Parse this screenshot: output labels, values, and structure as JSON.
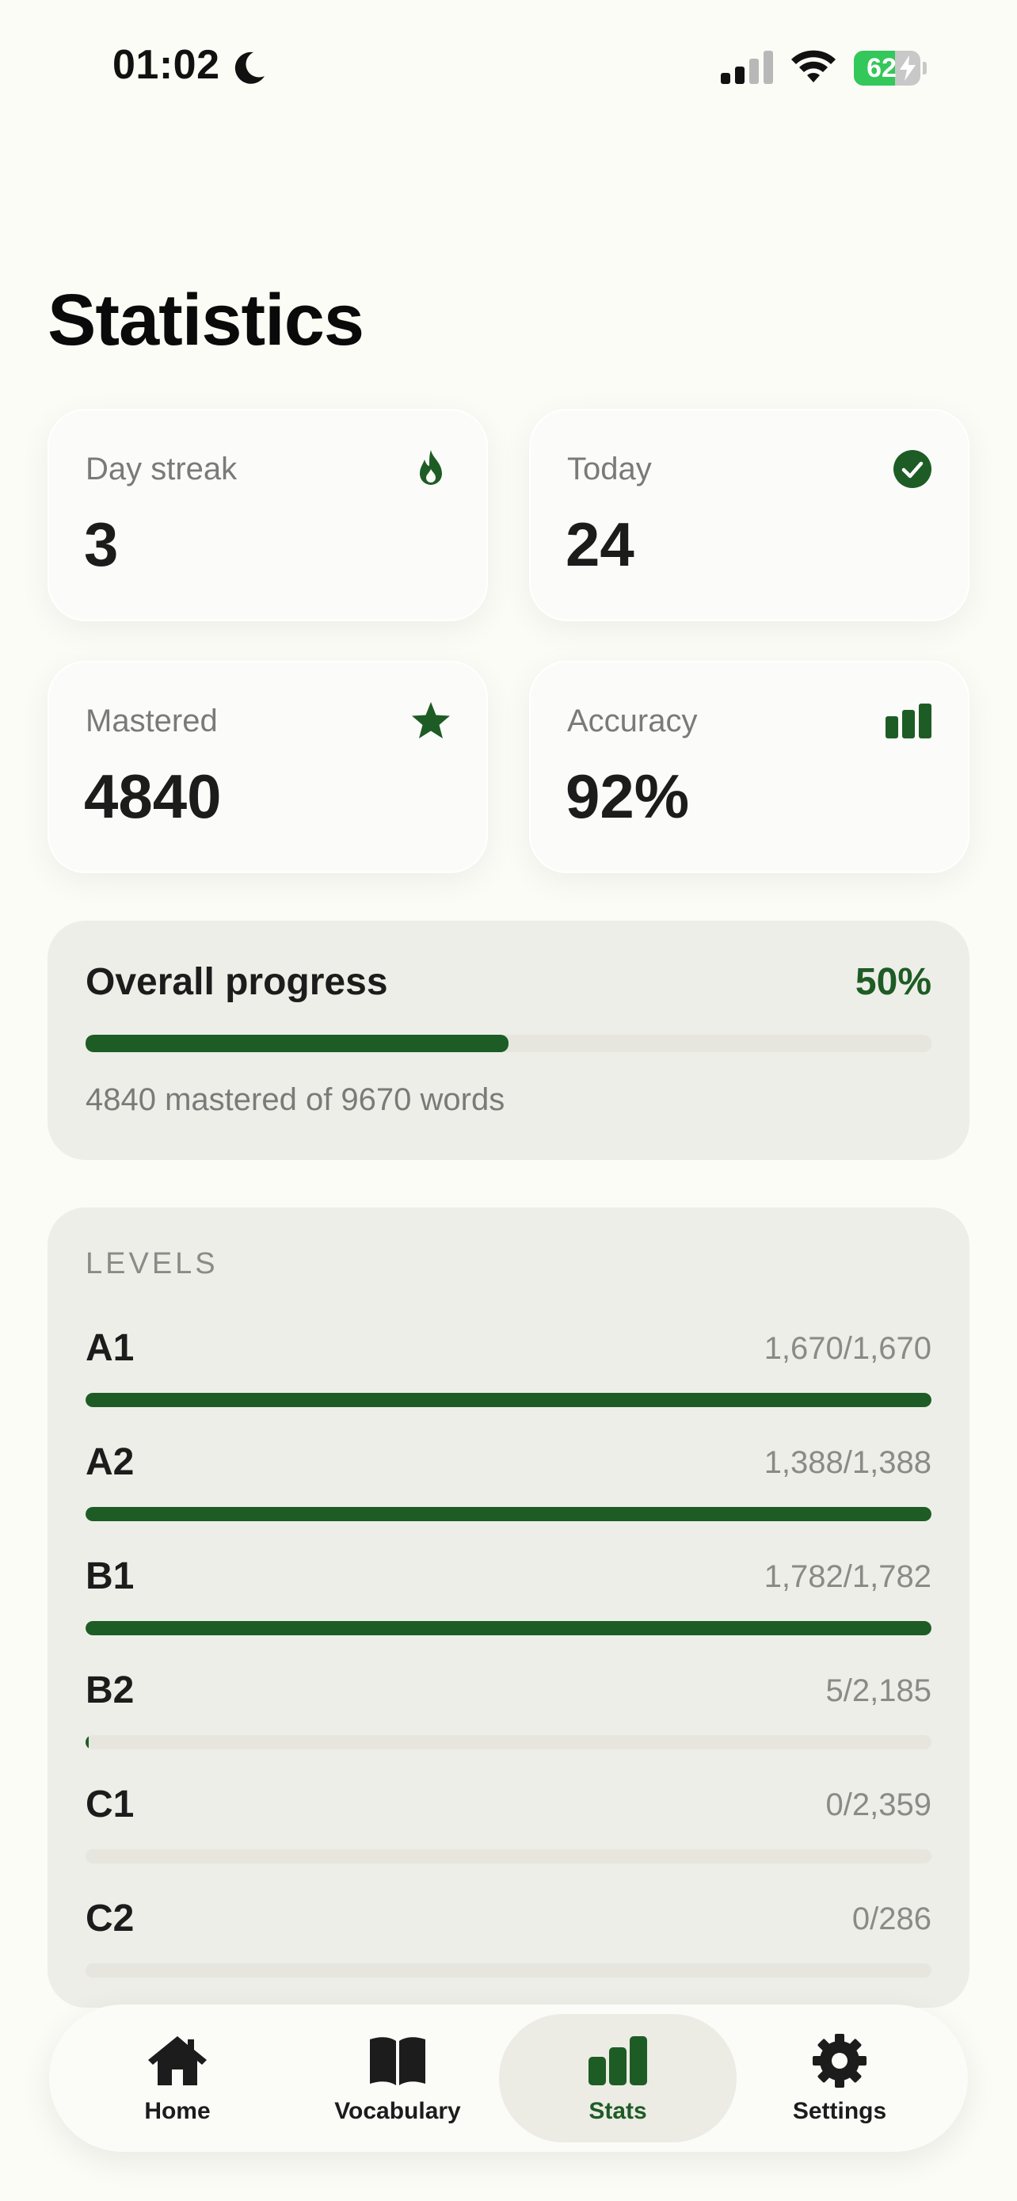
{
  "status_bar": {
    "time": "01:02",
    "battery": "62",
    "battery_level": 0.62,
    "icons": [
      "moon-icon",
      "cellular-signal-icon",
      "wifi-icon",
      "battery-charging-icon"
    ]
  },
  "page": {
    "title": "Statistics"
  },
  "stats": [
    {
      "label": "Day streak",
      "value": "3",
      "icon": "flame-icon"
    },
    {
      "label": "Today",
      "value": "24",
      "icon": "check-circle-icon"
    },
    {
      "label": "Mastered",
      "value": "4840",
      "icon": "star-icon"
    },
    {
      "label": "Accuracy",
      "value": "92%",
      "icon": "bar-chart-icon"
    }
  ],
  "overall": {
    "title": "Overall progress",
    "percent": "50%",
    "fraction": 0.5,
    "subtitle": "4840 mastered of 9670 words"
  },
  "levels": {
    "heading": "LEVELS",
    "items": [
      {
        "name": "A1",
        "count": "1,670/1,670",
        "fraction": 1.0
      },
      {
        "name": "A2",
        "count": "1,388/1,388",
        "fraction": 1.0
      },
      {
        "name": "B1",
        "count": "1,782/1,782",
        "fraction": 1.0
      },
      {
        "name": "B2",
        "count": "5/2,185",
        "fraction": 0.0023
      },
      {
        "name": "C1",
        "count": "0/2,359",
        "fraction": 0
      },
      {
        "name": "C2",
        "count": "0/286",
        "fraction": 0
      }
    ]
  },
  "tabs": [
    {
      "label": "Home",
      "icon": "house-icon",
      "active": false
    },
    {
      "label": "Vocabulary",
      "icon": "book-icon",
      "active": false
    },
    {
      "label": "Stats",
      "icon": "bar-chart-icon",
      "active": true
    },
    {
      "label": "Settings",
      "icon": "gear-icon",
      "active": false
    }
  ],
  "colors": {
    "accent": "#1e5c26",
    "background": "#fcfcf6",
    "card": "#eeeee8",
    "battery_green": "#34c759"
  }
}
